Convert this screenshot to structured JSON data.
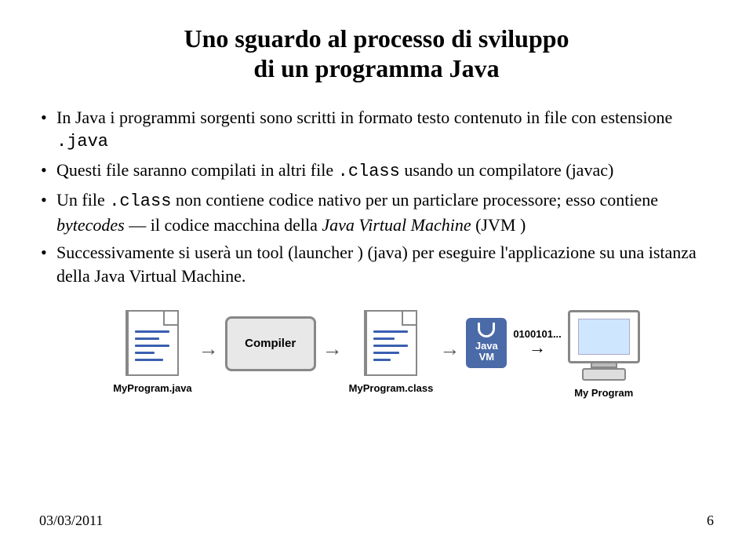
{
  "title_line1": "Uno sguardo al processo di sviluppo",
  "title_line2": "di un programma Java",
  "bullet1_a": "In Java i programmi sorgenti sono scritti in formato testo contenuto in file con estensione",
  "bullet1_b": ".java",
  "bullet2_a": "Questi file saranno compilati in altri file",
  "bullet2_b": ".class",
  "bullet2_c": " usando un compilatore (javac)",
  "bullet3_a": "Un file",
  "bullet3_b": ".class",
  "bullet3_c": " non contiene codice nativo per un particlare processore; esso contiene ",
  "bullet3_d": "bytecodes",
  "bullet3_e": " — il codice macchina della ",
  "bullet3_f": "Java Virtual Machine",
  "bullet3_g": " (JVM )",
  "bullet4": "Successivamente si userà un tool (launcher ) (java) per eseguire l'applicazione su una istanza della Java Virtual Machine.",
  "diagram": {
    "file1_label": "MyProgram.java",
    "compiler_label": "Compiler",
    "file2_label": "MyProgram.class",
    "jvm_line1": "Java",
    "jvm_line2": "VM",
    "bits1": "0100101...",
    "computer_label": "My Program"
  },
  "footer_date": "03/03/2011",
  "footer_page": "6"
}
